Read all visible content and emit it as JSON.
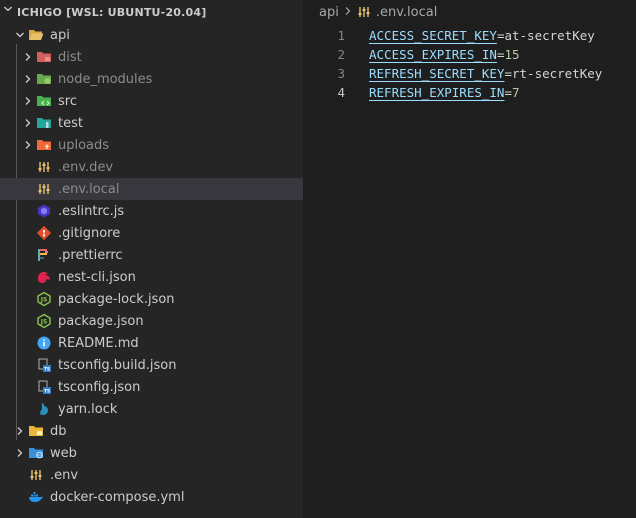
{
  "explorer": {
    "workspace_title": "ICHIGO [WSL: UBUNTU-20.04]",
    "tree": [
      {
        "label": "api",
        "icon": "folder-open-icon",
        "indent": 0,
        "chevron": "down"
      },
      {
        "label": "dist",
        "icon": "folder-dist-icon",
        "indent": 1,
        "chevron": "right",
        "dim": true
      },
      {
        "label": "node_modules",
        "icon": "folder-node-icon",
        "indent": 1,
        "chevron": "right",
        "dim": true
      },
      {
        "label": "src",
        "icon": "folder-src-icon",
        "indent": 1,
        "chevron": "right"
      },
      {
        "label": "test",
        "icon": "folder-test-icon",
        "indent": 1,
        "chevron": "right"
      },
      {
        "label": "uploads",
        "icon": "folder-uploads-icon",
        "indent": 1,
        "chevron": "right",
        "dim": true
      },
      {
        "label": ".env.dev",
        "icon": "env-file-icon",
        "indent": 1,
        "dim": true
      },
      {
        "label": ".env.local",
        "icon": "env-file-icon",
        "indent": 1,
        "selected": true,
        "dim": true
      },
      {
        "label": ".eslintrc.js",
        "icon": "eslint-icon",
        "indent": 1
      },
      {
        "label": ".gitignore",
        "icon": "git-icon",
        "indent": 1
      },
      {
        "label": ".prettierrc",
        "icon": "prettier-icon",
        "indent": 1
      },
      {
        "label": "nest-cli.json",
        "icon": "nest-icon",
        "indent": 1
      },
      {
        "label": "package-lock.json",
        "icon": "nodejs-icon",
        "indent": 1
      },
      {
        "label": "package.json",
        "icon": "nodejs-icon",
        "indent": 1
      },
      {
        "label": "README.md",
        "icon": "info-icon",
        "indent": 1
      },
      {
        "label": "tsconfig.build.json",
        "icon": "tsconfig-icon",
        "indent": 1
      },
      {
        "label": "tsconfig.json",
        "icon": "tsconfig-icon",
        "indent": 1
      },
      {
        "label": "yarn.lock",
        "icon": "yarn-icon",
        "indent": 1
      },
      {
        "label": "db",
        "icon": "folder-db-icon",
        "indent": 0,
        "chevron": "right"
      },
      {
        "label": "web",
        "icon": "folder-web-icon",
        "indent": 0,
        "chevron": "right"
      },
      {
        "label": ".env",
        "icon": "env-file-icon",
        "indent": 0
      },
      {
        "label": "docker-compose.yml",
        "icon": "docker-icon",
        "indent": 0
      }
    ]
  },
  "editor": {
    "breadcrumb": {
      "folder": "api",
      "file": ".env.local"
    },
    "lines": [
      {
        "num": "1",
        "key": "ACCESS_SECRET_KEY",
        "op": "=",
        "value": "at-secretKey",
        "value_type": "string"
      },
      {
        "num": "2",
        "key": "ACCESS_EXPIRES_IN",
        "op": "=",
        "value": "15",
        "value_type": "number"
      },
      {
        "num": "3",
        "key": "REFRESH_SECRET_KEY",
        "op": "=",
        "value": "rt-secretKey",
        "value_type": "string"
      },
      {
        "num": "4",
        "key": "REFRESH_EXPIRES_IN",
        "op": "=",
        "value": "7",
        "value_type": "number",
        "active": true
      }
    ]
  },
  "colors": {
    "sidebar_bg": "#252526",
    "editor_bg": "#1e1e1e",
    "selection_bg": "#37373d",
    "key_color": "#9cdcfe",
    "number_color": "#b5cea8"
  }
}
